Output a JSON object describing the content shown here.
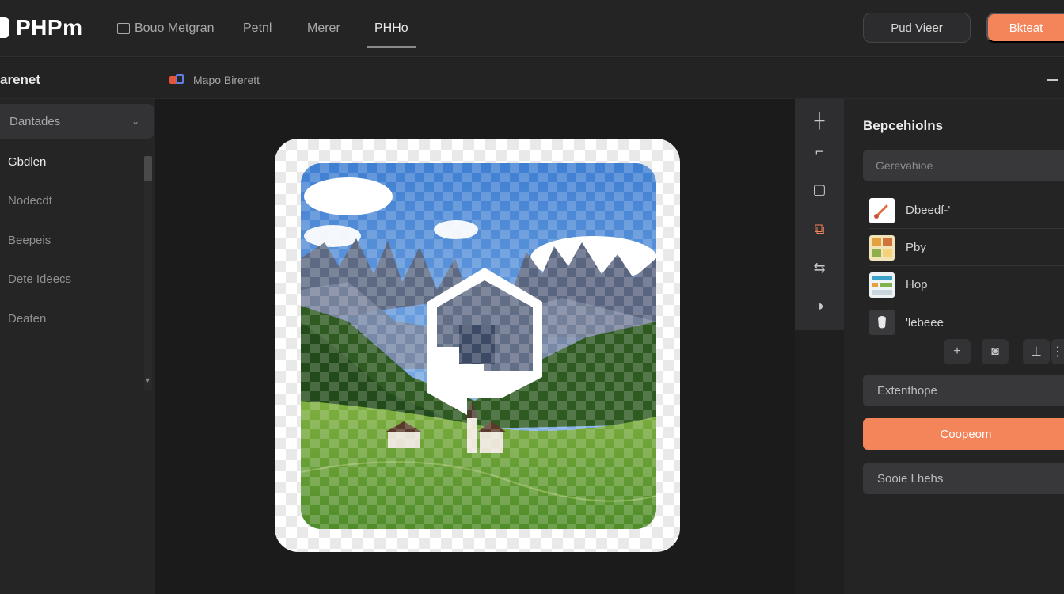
{
  "app": {
    "brand": "PHPm"
  },
  "nav": {
    "items": [
      {
        "label": "Bouo Metgran"
      },
      {
        "label": "Petnl"
      },
      {
        "label": "Merer"
      },
      {
        "label": "PHHo"
      }
    ],
    "active_index": 3
  },
  "header_actions": {
    "secondary_label": "Pud Vieer",
    "primary_label": "Bkteat"
  },
  "subbar": {
    "left_title": "arenet",
    "breadcrumb": "Mapo Birerett"
  },
  "left_panel": {
    "dropdown_label": "Dantades",
    "items": [
      {
        "label": "Gbdlen",
        "active": true
      },
      {
        "label": "Nodecdt",
        "active": false
      },
      {
        "label": "Beepeis",
        "active": false
      },
      {
        "label": "Dete Ideecs",
        "active": false
      },
      {
        "label": "Deaten",
        "active": false
      }
    ]
  },
  "tools": [
    {
      "icon": "crosshair-icon",
      "glyph": "┼"
    },
    {
      "icon": "crop-icon",
      "glyph": "⌐"
    },
    {
      "icon": "frame-icon",
      "glyph": "▢"
    },
    {
      "icon": "layers-icon",
      "glyph": "⧉",
      "active": true
    },
    {
      "icon": "adjust-icon",
      "glyph": "⇆"
    },
    {
      "icon": "mask-icon",
      "glyph": "◑"
    }
  ],
  "right_panel": {
    "title": "Bepcehiolns",
    "search_placeholder": "Gerevahioe",
    "layers": [
      {
        "label": "Dbeedf-'",
        "thumb": "brush-thumb"
      },
      {
        "label": "Pby",
        "thumb": "palette-thumb"
      },
      {
        "label": "Hop",
        "thumb": "grid-thumb"
      },
      {
        "label": "'lebeee",
        "thumb": "tooth-thumb"
      }
    ],
    "layer_actions": [
      {
        "icon": "plus-icon",
        "glyph": "+"
      },
      {
        "icon": "duplicate-icon",
        "glyph": "◙"
      },
      {
        "icon": "merge-icon",
        "glyph": "⊥"
      },
      {
        "icon": "more-icon",
        "glyph": "⋮"
      }
    ],
    "field_label": "Extenthope",
    "primary_button": "Coopeom",
    "secondary_field": "Sooie Lhehs"
  },
  "colors": {
    "accent": "#f4845a",
    "background": "#1e1e1f",
    "panel": "#242425"
  }
}
